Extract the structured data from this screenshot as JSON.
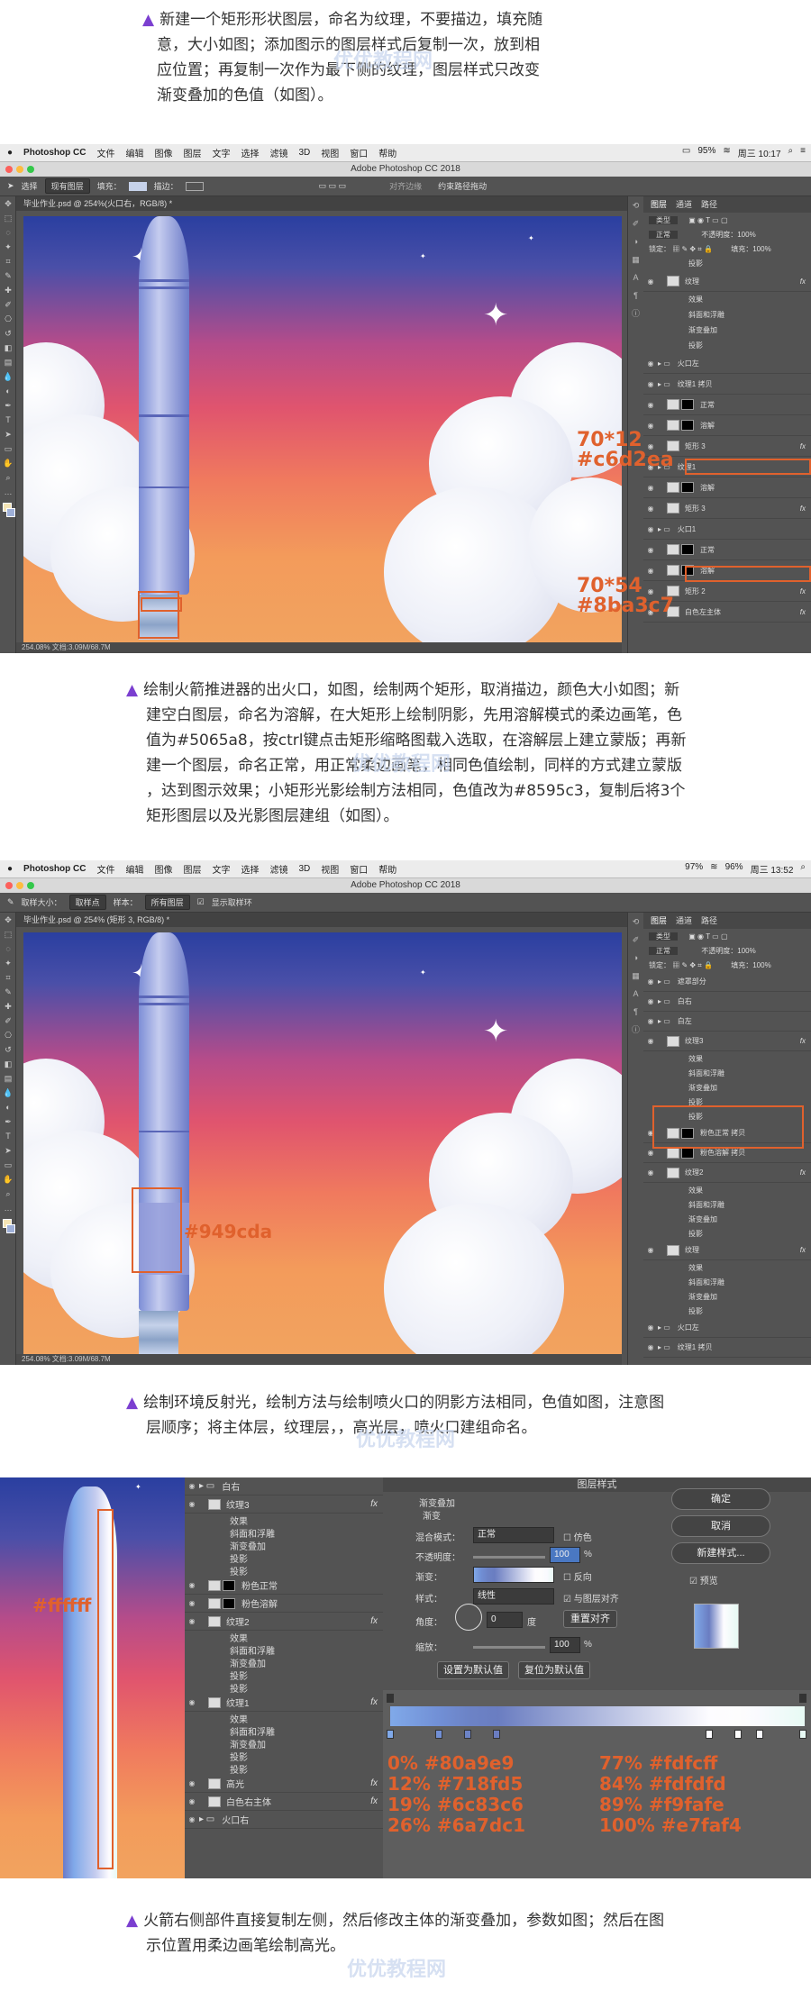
{
  "steps": {
    "s1": {
      "line1": "新建一个矩形形状图层，命名为纹理，不要描边，填充随",
      "line2": "意，大小如图；添加图示的图层样式后复制一次，放到相",
      "line3": "应位置；再复制一次作为最下侧的纹理，图层样式只改变",
      "line4": "渐变叠加的色值（如图）。"
    },
    "s2": {
      "line1": "绘制火箭推进器的出火口，如图，绘制两个矩形，取消描边，颜色大小如图；新",
      "line2": "建空白图层，命名为溶解，在大矩形上绘制阴影，先用溶解模式的柔边画笔，色",
      "line3": "值为#5065a8，按ctrl键点击矩形缩略图载入选取，在溶解层上建立蒙版；再新",
      "line4": "建一个图层，命名正常，用正常柔边画笔，相同色值绘制，同样的方式建立蒙版",
      "line5": "，达到图示效果；小矩形光影绘制方法相同，色值改为#8595c3，复制后将3个",
      "line6": "矩形图层以及光影图层建组（如图）。"
    },
    "s3": {
      "line1": "绘制环境反射光，绘制方法与绘制喷火口的阴影方法相同，色值如图，注意图",
      "line2": "层顺序；将主体层，纹理层，，高光层，喷火口建组命名。"
    },
    "s4": {
      "line1": "火箭右侧部件直接复制左侧，然后修改主体的渐变叠加，参数如图；然后在图",
      "line2": "示位置用柔边画笔绘制高光。"
    }
  },
  "watermark": "优优教程网",
  "shot1": {
    "menu": [
      "Photoshop CC",
      "文件",
      "编辑",
      "图像",
      "图层",
      "文字",
      "选择",
      "滤镜",
      "3D",
      "视图",
      "窗口",
      "帮助"
    ],
    "status_right": [
      "95%",
      "周三 10:17"
    ],
    "window_title": "Adobe Photoshop CC 2018",
    "options": {
      "tool": "选择",
      "mode": "现有图层",
      "fill": "填充：",
      "stroke": "描边：",
      "align": "对齐边缘",
      "constrain": "约束路径拖动"
    },
    "doc_tab": "毕业作业.psd @ 254%(火口右，RGB/8) *",
    "status": "254.08%     文档:3.09M/68.7M",
    "panel_tabs": [
      "图层",
      "通道",
      "路径"
    ],
    "kind": "类型",
    "blend": "正常",
    "opacity_label": "不透明度：",
    "opacity": "100%",
    "lock_label": "锁定：",
    "fill_label": "填充：",
    "fill": "100%",
    "layers": [
      {
        "name": "投影",
        "type": "effect"
      },
      {
        "name": "纹理",
        "type": "layer"
      },
      {
        "name": "效果",
        "type": "effect"
      },
      {
        "name": "斜面和浮雕",
        "type": "effect"
      },
      {
        "name": "渐变叠加",
        "type": "effect"
      },
      {
        "name": "投影",
        "type": "effect"
      },
      {
        "name": "火口左",
        "type": "group"
      },
      {
        "name": "纹理1 拷贝",
        "type": "group"
      },
      {
        "name": "正常",
        "type": "mask"
      },
      {
        "name": "溶解",
        "type": "mask"
      },
      {
        "name": "矩形 3",
        "type": "layer"
      },
      {
        "name": "纹理1",
        "type": "group"
      },
      {
        "name": "溶解",
        "type": "mask"
      },
      {
        "name": "矩形 3",
        "type": "layer"
      },
      {
        "name": "火口1",
        "type": "group"
      },
      {
        "name": "正常",
        "type": "mask"
      },
      {
        "name": "溶解",
        "type": "mask"
      },
      {
        "name": "矩形 2",
        "type": "layer"
      },
      {
        "name": "白色左主体",
        "type": "layer"
      }
    ],
    "annotations": [
      {
        "size": "70*12",
        "color": "#c6d2ea"
      },
      {
        "size": "70*54",
        "color": "#8ba3c7"
      }
    ]
  },
  "shot2": {
    "status_right": [
      "97%",
      "96%",
      "周三 13:52"
    ],
    "window_title": "Adobe Photoshop CC 2018",
    "options": {
      "size": "取样大小：",
      "size_val": "取样点",
      "sample": "样本：",
      "sample_val": "所有图层",
      "ring": "显示取样环"
    },
    "doc_tab": "毕业作业.psd @ 254% (矩形 3, RGB/8) *",
    "status": "254.08%     文档:3.09M/68.7M",
    "layers": [
      {
        "name": "遮罩部分",
        "type": "group"
      },
      {
        "name": "白右",
        "type": "group"
      },
      {
        "name": "白左",
        "type": "group"
      },
      {
        "name": "纹理3",
        "type": "layer"
      },
      {
        "name": "效果",
        "type": "effect"
      },
      {
        "name": "斜面和浮雕",
        "type": "effect"
      },
      {
        "name": "渐变叠加",
        "type": "effect"
      },
      {
        "name": "投影",
        "type": "effect"
      },
      {
        "name": "投影",
        "type": "effect"
      },
      {
        "name": "粉色正常 拷贝",
        "type": "mask"
      },
      {
        "name": "粉色溶解 拷贝",
        "type": "mask"
      },
      {
        "name": "纹理2",
        "type": "layer"
      },
      {
        "name": "效果",
        "type": "effect"
      },
      {
        "name": "斜面和浮雕",
        "type": "effect"
      },
      {
        "name": "渐变叠加",
        "type": "effect"
      },
      {
        "name": "投影",
        "type": "effect"
      },
      {
        "name": "纹理",
        "type": "layer"
      },
      {
        "name": "效果",
        "type": "effect"
      },
      {
        "name": "斜面和浮雕",
        "type": "effect"
      },
      {
        "name": "渐变叠加",
        "type": "effect"
      },
      {
        "name": "投影",
        "type": "effect"
      },
      {
        "name": "火口左",
        "type": "group"
      },
      {
        "name": "纹理1 拷贝",
        "type": "group"
      }
    ],
    "annotation": "#949cda"
  },
  "shot3": {
    "annotation": "#ffffff",
    "layers": [
      {
        "name": "白右",
        "type": "group"
      },
      {
        "name": "纹理3",
        "type": "layer"
      },
      {
        "name": "效果",
        "type": "effect"
      },
      {
        "name": "斜面和浮雕",
        "type": "effect"
      },
      {
        "name": "渐变叠加",
        "type": "effect"
      },
      {
        "name": "投影",
        "type": "effect"
      },
      {
        "name": "投影",
        "type": "effect"
      },
      {
        "name": "粉色正常",
        "type": "mask"
      },
      {
        "name": "粉色溶解",
        "type": "mask"
      },
      {
        "name": "纹理2",
        "type": "layer"
      },
      {
        "name": "效果",
        "type": "effect"
      },
      {
        "name": "斜面和浮雕",
        "type": "effect"
      },
      {
        "name": "渐变叠加",
        "type": "effect"
      },
      {
        "name": "投影",
        "type": "effect"
      },
      {
        "name": "投影",
        "type": "effect"
      },
      {
        "name": "纹理1",
        "type": "layer"
      },
      {
        "name": "效果",
        "type": "effect"
      },
      {
        "name": "斜面和浮雕",
        "type": "effect"
      },
      {
        "name": "渐变叠加",
        "type": "effect"
      },
      {
        "name": "投影",
        "type": "effect"
      },
      {
        "name": "投影",
        "type": "effect"
      },
      {
        "name": "高光",
        "type": "layer"
      },
      {
        "name": "白色右主体",
        "type": "layer"
      },
      {
        "name": "火口右",
        "type": "group"
      }
    ],
    "dialog": {
      "title": "图层样式",
      "section": "渐变叠加",
      "subsection": "渐变",
      "blend_label": "混合模式：",
      "blend": "正常",
      "dither": "仿色",
      "opacity_label": "不透明度：",
      "opacity": "100",
      "pct": "%",
      "gradient_label": "渐变：",
      "reverse": "反向",
      "style_label": "样式：",
      "style": "线性",
      "align": "与图层对齐",
      "angle_label": "角度：",
      "angle": "0",
      "deg": "度",
      "reset_align": "重置对齐",
      "scale_label": "缩放：",
      "scale": "100",
      "set_default": "设置为默认值",
      "reset_default": "复位为默认值",
      "ok": "确定",
      "cancel": "取消",
      "new_style": "新建样式...",
      "preview": "预览"
    },
    "stops_left": [
      "0%  #80a9e9",
      "12% #718fd5",
      "19% #6c83c6",
      "26% #6a7dc1"
    ],
    "stops_right": [
      "77%  #fdfcff",
      "84%  #fdfdfd",
      "89%  #f9fafe",
      "100% #e7faf4"
    ]
  }
}
